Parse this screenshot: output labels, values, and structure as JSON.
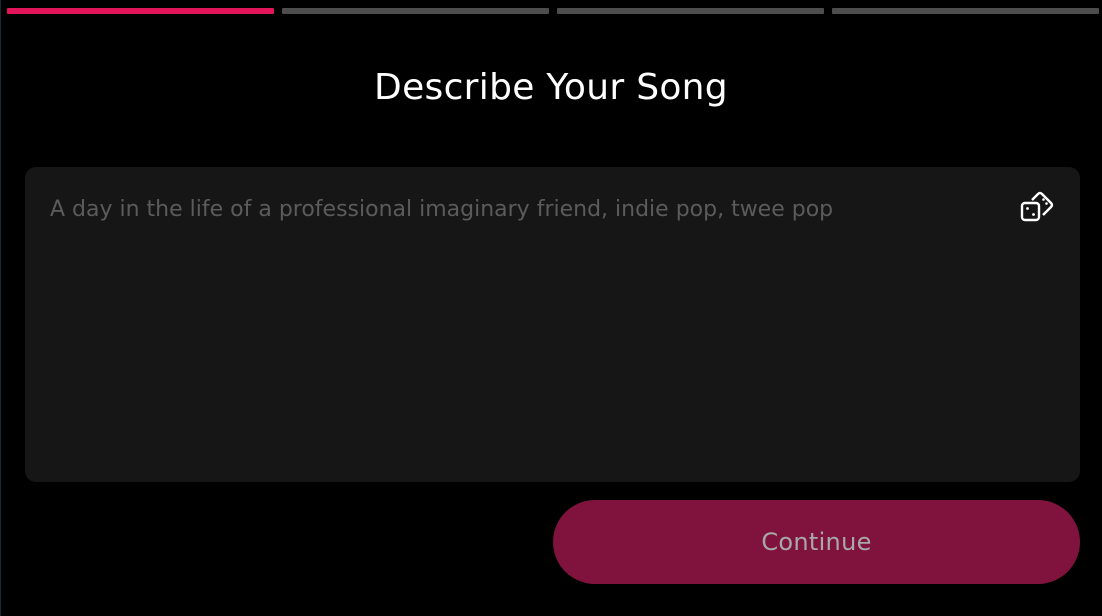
{
  "progress": {
    "total_steps": 4,
    "current_step": 1,
    "active_color": "#e2145a",
    "inactive_color": "#4d4d4d"
  },
  "page": {
    "title": "Describe Your Song"
  },
  "prompt": {
    "placeholder": "A day in the life of a professional imaginary friend, indie pop, twee pop",
    "value": "",
    "randomize_icon": "dice-icon"
  },
  "actions": {
    "continue_label": "Continue",
    "continue_color": "#80133d"
  }
}
